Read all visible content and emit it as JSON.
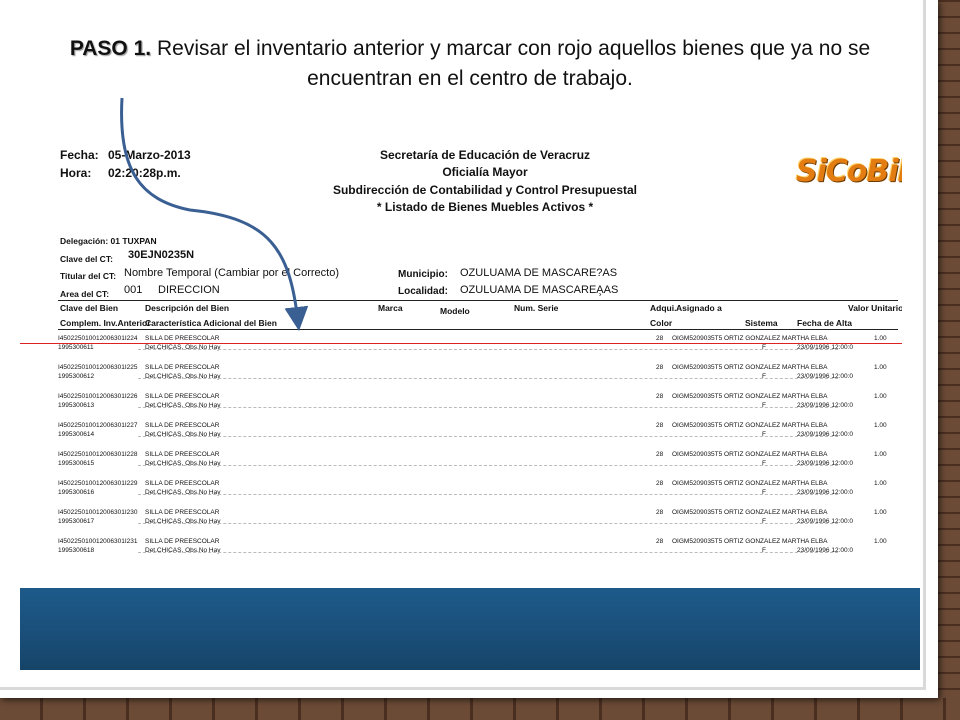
{
  "title": {
    "lead": "PASO 1.",
    "text": "Revisar el inventario anterior y marcar con rojo aquellos bienes que ya no se encuentran en el centro de trabajo."
  },
  "report": {
    "fecha_label": "Fecha:",
    "fecha_value": "05-Marzo-2013",
    "hora_label": "Hora:",
    "hora_value": "02:20:28p.m.",
    "org": "Secretaría de Educación de Veracruz",
    "dept": "Oficialía Mayor",
    "subdept": "Subdirección de Contabilidad y Control Presupuestal",
    "list_title": "* Listado de Bienes Muebles Activos *",
    "logo": "SiCoBiP",
    "delegacion": "Delegación: 01 TUXPAN",
    "clave_label": "Clave del CT:",
    "clave_value": "30EJN0235N",
    "titular_label": "Titular del CT:",
    "titular_value": "Nombre Temporal (Cambiar por el Correcto)",
    "area_label": "Area del CT:",
    "area_code": "001",
    "area_value": "DIRECCION",
    "municipio_label": "Municipio:",
    "municipio_value": "OZULUAMA DE MASCARE?AS",
    "localidad_label": "Localidad:",
    "localidad_value": "OZULUAMA DE MASCAREA̧AS",
    "columns": {
      "clave": "Clave del Bien",
      "complem": "Complem. Inv.Anterior",
      "descripcion": "Descripción del Bien",
      "caracteristica": "Característica Adicional del Bien",
      "marca": "Marca",
      "modelo": "Modelo",
      "serie": "Num. Serie",
      "adqui": "Adqui.",
      "color": "Color",
      "asignado": "Asignado a",
      "sistema": "Sistema",
      "fecha_alta": "Fecha de Alta",
      "valor": "Valor Unitario"
    },
    "rows": [
      {
        "clave": "I450225010012006301I224",
        "ant": "1995300611",
        "desc": "SILLA DE PREESCOLAR",
        "det": "Det.CHICAS, Obs.No Hay",
        "adq": "28",
        "asignado": "OIGM5209035T5 ORTIZ GONZALEZ MARTHA ELBA",
        "sistema": "F",
        "fecha": "23/09/1996 12:00:0",
        "valor": "1.00"
      },
      {
        "clave": "I450225010012006301I225",
        "ant": "1995300612",
        "desc": "SILLA DE PREESCOLAR",
        "det": "Det.CHICAS, Obs.No Hay",
        "adq": "28",
        "asignado": "OIGM5209035T5 ORTIZ GONZALEZ MARTHA ELBA",
        "sistema": "F",
        "fecha": "23/09/1996 12:00:0",
        "valor": "1.00"
      },
      {
        "clave": "I450225010012006301I226",
        "ant": "1995300613",
        "desc": "SILLA DE PREESCOLAR",
        "det": "Det.CHICAS, Obs.No Hay",
        "adq": "28",
        "asignado": "OIGM5209035T5 ORTIZ GONZALEZ MARTHA ELBA",
        "sistema": "F",
        "fecha": "23/09/1996 12:00:0",
        "valor": "1.00"
      },
      {
        "clave": "I450225010012006301I227",
        "ant": "1995300614",
        "desc": "SILLA DE PREESCOLAR",
        "det": "Det.CHICAS, Obs.No Hay",
        "adq": "28",
        "asignado": "OIGM5209035T5 ORTIZ GONZALEZ MARTHA ELBA",
        "sistema": "F",
        "fecha": "23/09/1996 12:00:0",
        "valor": "1.00"
      },
      {
        "clave": "I450225010012006301I228",
        "ant": "1995300615",
        "desc": "SILLA DE PREESCOLAR",
        "det": "Det.CHICAS, Obs.No Hay",
        "adq": "28",
        "asignado": "OIGM5209035T5 ORTIZ GONZALEZ MARTHA ELBA",
        "sistema": "F",
        "fecha": "23/09/1996 12:00:0",
        "valor": "1.00"
      },
      {
        "clave": "I450225010012006301I229",
        "ant": "1995300616",
        "desc": "SILLA DE PREESCOLAR",
        "det": "Det.CHICAS, Obs.No Hay",
        "adq": "28",
        "asignado": "OIGM5209035T5 ORTIZ GONZALEZ MARTHA ELBA",
        "sistema": "F",
        "fecha": "23/09/1996 12:00:0",
        "valor": "1.00"
      },
      {
        "clave": "I450225010012006301I230",
        "ant": "1995300617",
        "desc": "SILLA DE PREESCOLAR",
        "det": "Det.CHICAS, Obs.No Hay",
        "adq": "28",
        "asignado": "OIGM5209035T5 ORTIZ GONZALEZ MARTHA ELBA",
        "sistema": "F",
        "fecha": "23/09/1996 12:00:0",
        "valor": "1.00"
      },
      {
        "clave": "I450225010012006301I231",
        "ant": "1995300618",
        "desc": "SILLA DE PREESCOLAR",
        "det": "Det.CHICAS, Obs.No Hay",
        "adq": "28",
        "asignado": "OIGM5209035T5 ORTIZ GONZALEZ MARTHA ELBA",
        "sistema": "F",
        "fecha": "23/09/1996 12:00:0",
        "valor": "1.00"
      }
    ]
  },
  "colors": {
    "accent_arrow": "#3a5f93",
    "footer_bar": "#1a4f7a",
    "marker_line": "#dd2222",
    "logo": "#e37d12"
  },
  "icons": {
    "arrow": "curved-arrow-icon"
  }
}
